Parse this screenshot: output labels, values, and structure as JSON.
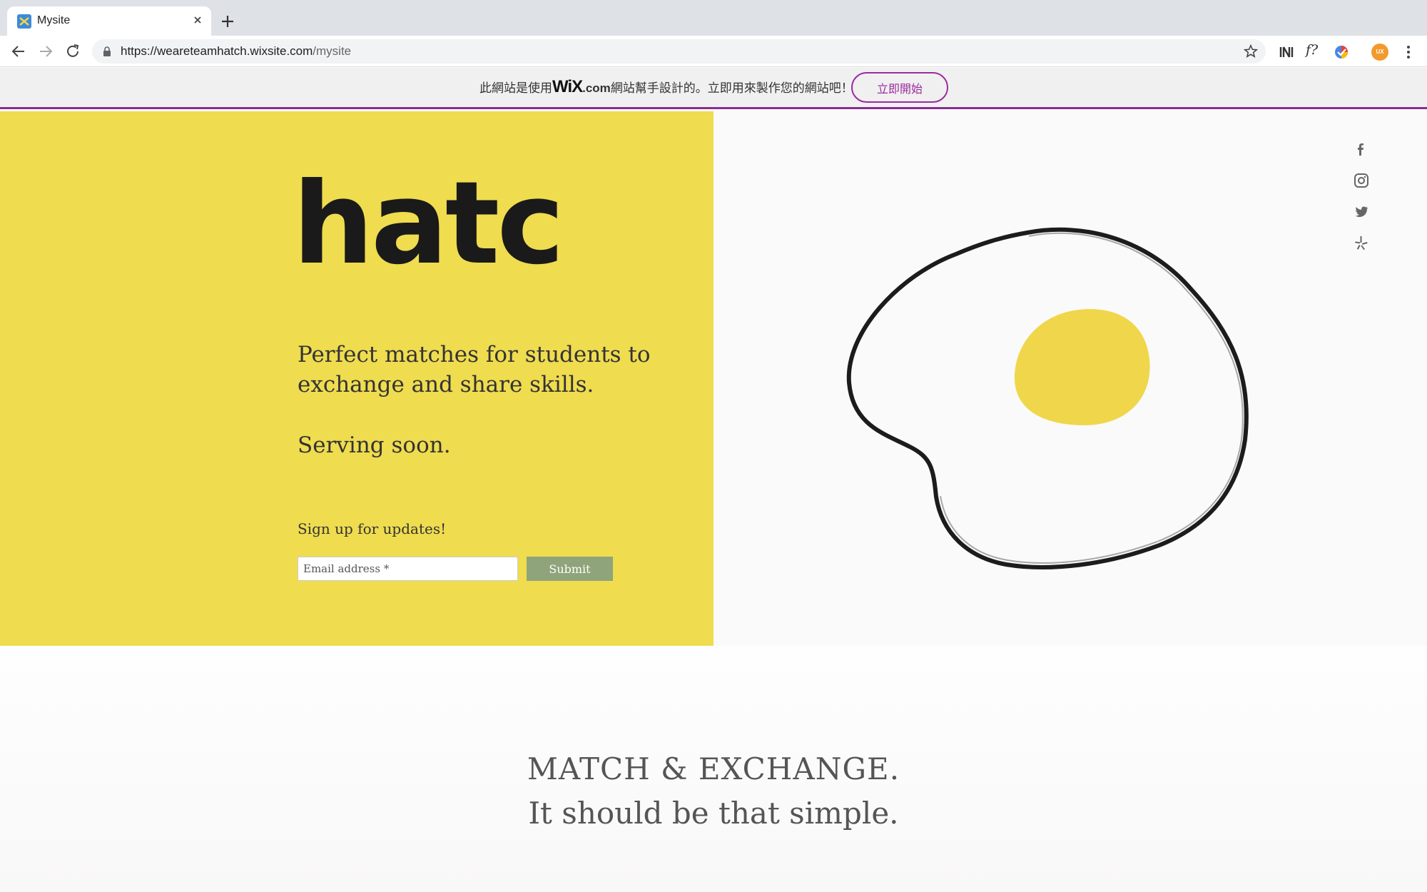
{
  "browser": {
    "tab_title": "Mysite",
    "url_scheme_host": "https://weareteamhatch.wixsite.com",
    "url_path": "/mysite",
    "extension_fx_label": "f?",
    "avatar_initials": "UX"
  },
  "wix_banner": {
    "text_before": "此網站是使用",
    "logo_text": "WiX",
    "dotcom": ".com",
    "text_after": "網站幫手設計的。立即用來製作您的網站吧！",
    "cta_label": "立即開始",
    "accent_color": "#9c2a9e"
  },
  "hero": {
    "logo_text": "hatch",
    "tagline": "Perfect matches for students to exchange and share skills.",
    "serving": "Serving soon.",
    "signup_title": "Sign up for updates!",
    "email_placeholder": "Email address *",
    "submit_label": "Submit",
    "colors": {
      "left_bg": "#efdc4f",
      "submit_bg": "#8fa47a",
      "yolk": "#f0d64a"
    }
  },
  "social": [
    "facebook-icon",
    "instagram-icon",
    "twitter-icon",
    "yelp-icon"
  ],
  "section2": {
    "heading": "MATCH & EXCHANGE.",
    "subheading": "It should be that simple."
  }
}
